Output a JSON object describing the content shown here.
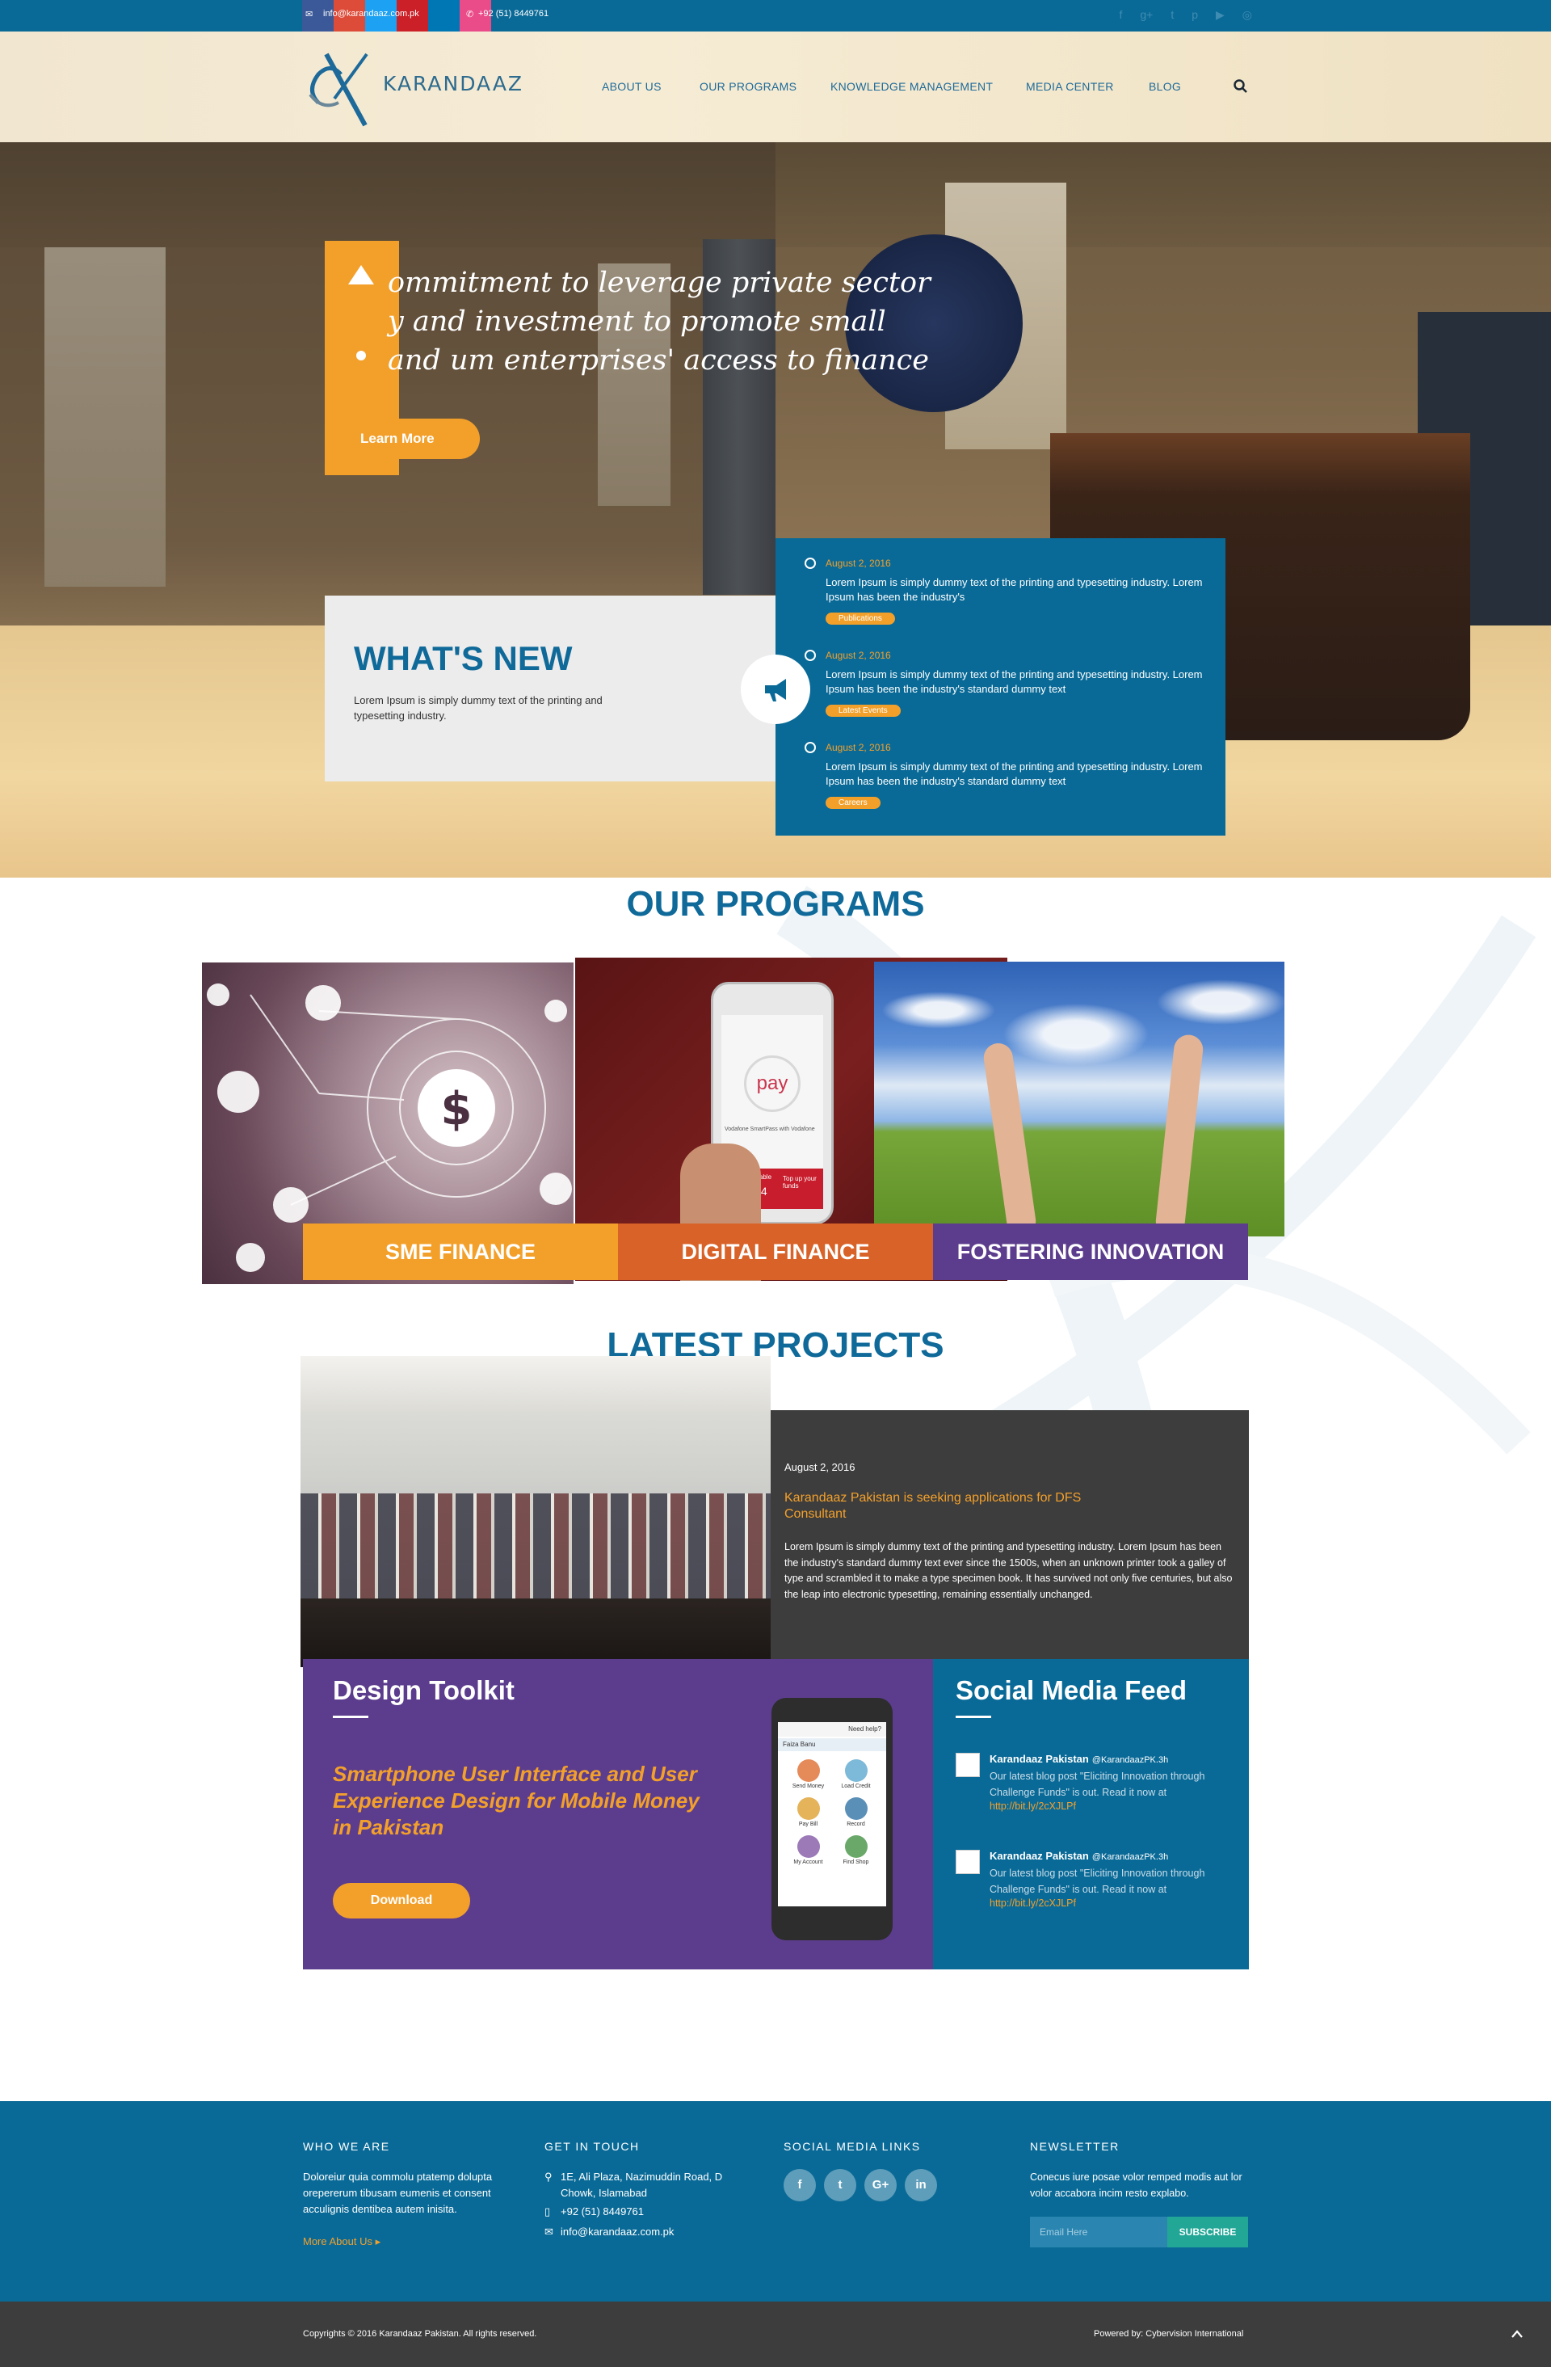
{
  "topbar": {
    "email": "info@karandaaz.com.pk",
    "phone": "+92 (51) 8449761",
    "social_colors": [
      "#3b5998",
      "#dd4b39",
      "#1da1f2",
      "#cb2027",
      "#0077b5",
      "#ea4c89"
    ]
  },
  "header": {
    "logo_text": "KARANDAAZ",
    "nav": [
      "ABOUT US",
      "OUR PROGRAMS",
      "KNOWLEDGE MANAGEMENT",
      "MEDIA CENTER",
      "BLOG"
    ]
  },
  "hero": {
    "tagline": "ommitment to leverage private sector y and investment to promote small and um enterprises' access to finance",
    "button": "Learn More"
  },
  "whats_new": {
    "title": "WHAT'S NEW",
    "description": "Lorem Ipsum is simply dummy text of the printing and typesetting industry.",
    "items": [
      {
        "date": "August 2, 2016",
        "text": "Lorem Ipsum is simply dummy text of the printing and typesetting industry. Lorem Ipsum has been the industry's",
        "tag": "Publications"
      },
      {
        "date": "August 2, 2016",
        "text": "Lorem Ipsum is simply dummy text of the printing and typesetting industry. Lorem Ipsum has been the industry's standard dummy text",
        "tag": "Latest Events"
      },
      {
        "date": "August 2, 2016",
        "text": "Lorem Ipsum is simply dummy text of the printing and typesetting industry. Lorem Ipsum has been the industry's standard dummy text",
        "tag": "Careers"
      }
    ]
  },
  "programs": {
    "title": "OUR PROGRAMS",
    "items": [
      {
        "label": "SME FINANCE",
        "color": "#f3a02b"
      },
      {
        "label": "DIGITAL FINANCE",
        "color": "#d86228"
      },
      {
        "label": "FOSTERING INNOVATION",
        "color": "#5c3d8d"
      }
    ],
    "phone_screen": {
      "pay": "pay",
      "brand": "Vodafone SmartPass with Vodafone",
      "funds_label": "Funds available",
      "funds_value": "$344.14",
      "topup": "Top up your funds"
    }
  },
  "latest_projects": {
    "title": "LATEST PROJECTS",
    "date": "August 2, 2016",
    "headline": "Karandaaz Pakistan is seeking applications for DFS Consultant",
    "body": "Lorem Ipsum is simply dummy text of the printing and typesetting industry. Lorem Ipsum has been the industry's standard dummy text ever since the 1500s, when an unknown printer took a galley of type and scrambled it to make a type specimen book. It has survived not only five centuries, but also the leap into electronic typesetting, remaining essentially unchanged."
  },
  "toolkit": {
    "title": "Design Toolkit",
    "subtitle": "Smartphone User Interface and User Experience Design for Mobile Money in Pakistan",
    "button": "Download",
    "phone": {
      "header": "Need help?",
      "user": "Faiza Banu",
      "apps": [
        "Send Money",
        "Load Credit",
        "Pay Bill",
        "Record",
        "My Account",
        "Find Shop"
      ]
    }
  },
  "social_feed": {
    "title": "Social Media Feed",
    "tweets": [
      {
        "name": "Karandaaz Pakistan",
        "handle": "@KarandaazPK.3h",
        "text": "Our latest blog post \"Eliciting Innovation through Challenge Funds\" is out. Read it now at",
        "link": "http://bit.ly/2cXJLPf"
      },
      {
        "name": "Karandaaz Pakistan",
        "handle": "@KarandaazPK.3h",
        "text": "Our latest blog post \"Eliciting Innovation through Challenge Funds\" is out. Read it now at",
        "link": "http://bit.ly/2cXJLPf"
      }
    ]
  },
  "footer": {
    "who_title": "WHO WE ARE",
    "who_text": "Doloreiur quia commolu ptatemp dolupta orepererum tibusam eumenis et consent acculignis dentibea autem inisita.",
    "more_link": "More About Us",
    "contact_title": "GET IN TOUCH",
    "address": "1E, Ali Plaza, Nazimuddin Road, D Chowk, Islamabad",
    "phone": "+92 (51) 8449761",
    "email": "info@karandaaz.com.pk",
    "social_title": "SOCIAL MEDIA LINKS",
    "social": [
      "f",
      "t",
      "G+",
      "in"
    ],
    "newsletter_title": "NEWSLETTER",
    "newsletter_text": "Conecus iure posae volor remped modis aut lor volor accabora incim resto explabo.",
    "email_placeholder": "Email Here",
    "subscribe": "SUBSCRIBE"
  },
  "bottom": {
    "copyright": "Copyrights © 2016 Karandaaz Pakistan. All rights reserved.",
    "powered": "Powered by: Cybervision International"
  }
}
